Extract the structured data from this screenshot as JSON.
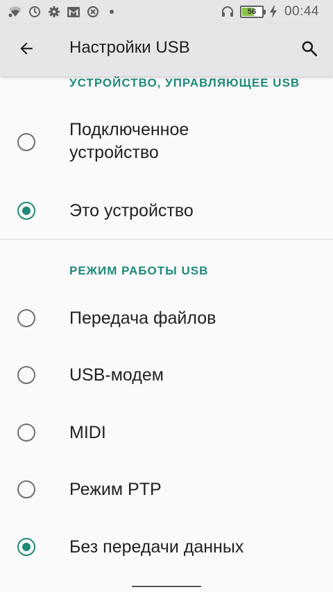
{
  "status_bar": {
    "icons": [
      "wifi-icon",
      "sync-icon",
      "settings-icon",
      "gmail-icon",
      "data-saver-icon",
      "notification-dot-icon"
    ],
    "right_icons": [
      "headphones-icon",
      "battery-icon",
      "charging-bolt-icon"
    ],
    "battery_level": "56",
    "time": "00:44"
  },
  "app_bar": {
    "title": "Настройки USB",
    "back_icon": "arrow-back-icon",
    "search_icon": "search-icon"
  },
  "sections": [
    {
      "header": "УСТРОЙСТВО, УПРАВЛЯЮЩЕЕ USB",
      "options": [
        {
          "label_line1": "Подключенное",
          "label_line2": "устройство",
          "checked": false
        },
        {
          "label": "Это устройство",
          "checked": true
        }
      ]
    },
    {
      "header": "РЕЖИМ РАБОТЫ USB",
      "options": [
        {
          "label": "Передача файлов",
          "checked": false
        },
        {
          "label": "USB-модем",
          "checked": false
        },
        {
          "label": "MIDI",
          "checked": false
        },
        {
          "label": "Режим PTP",
          "checked": false
        },
        {
          "label": "Без передачи данных",
          "checked": true
        }
      ]
    }
  ],
  "colors": {
    "accent": "#1f8a7a",
    "bar_background": "#e6e6e6",
    "page_background": "#fafafa",
    "text_primary": "#212121"
  }
}
